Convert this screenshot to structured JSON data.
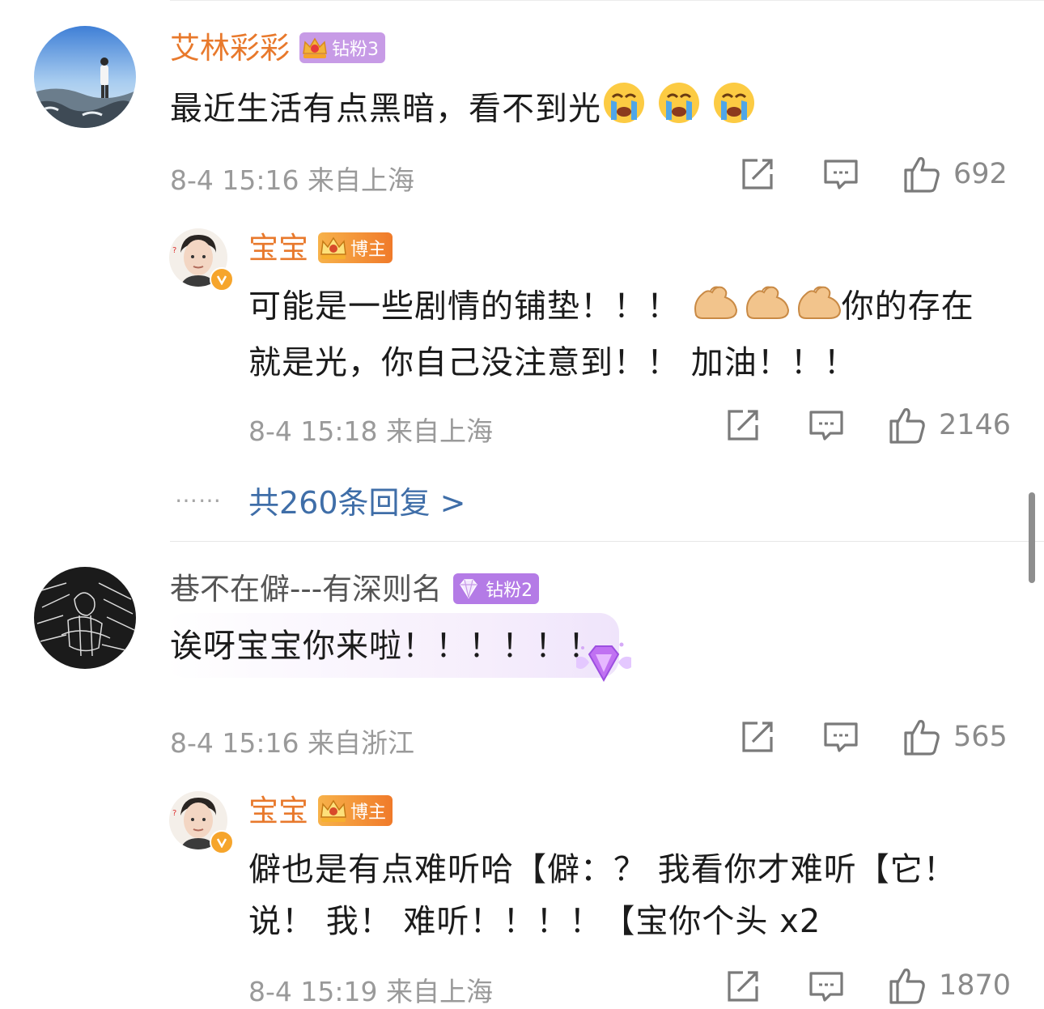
{
  "comments": [
    {
      "user": "艾林彩彩",
      "badge": "钻粉3",
      "text_prefix": "最近生活有点黑暗，看不到光",
      "emoji": "crying-face",
      "date": "8-4 15:16",
      "location": "来自上海",
      "likes": "692",
      "reply": {
        "user": "宝宝",
        "badge": "博主",
        "line1_prefix": "可能是一些剧情的铺垫！！！",
        "line1_suffix": "你的存在",
        "line2": "就是光，你自己没注意到！！ 加油！！！",
        "emoji": "flexed-biceps",
        "date": "8-4 15:18",
        "location": "来自上海",
        "likes": "2146"
      },
      "more_dots": "……",
      "more_replies": "共260条回复 >"
    },
    {
      "user": "巷不在僻---有深则名",
      "badge": "钻粉2",
      "text": "诶呀宝宝你来啦！！！！！！",
      "date": "8-4 15:16",
      "location": "来自浙江",
      "likes": "565",
      "reply": {
        "user": "宝宝",
        "badge": "博主",
        "line1": "僻也是有点难听哈【僻：？ 我看你才难听【它！",
        "line2": "说！ 我！ 难听！！！！【宝你个头 x2",
        "date": "8-4 15:19",
        "location": "来自上海",
        "likes": "1870"
      }
    }
  ],
  "colors": {
    "name_orange": "#e8792c",
    "link_blue": "#3f6ea8",
    "meta_gray": "#9a9a9a"
  },
  "icons": [
    "share-icon",
    "comment-icon",
    "like-icon",
    "crown-icon",
    "diamond-icon",
    "verified-icon"
  ]
}
